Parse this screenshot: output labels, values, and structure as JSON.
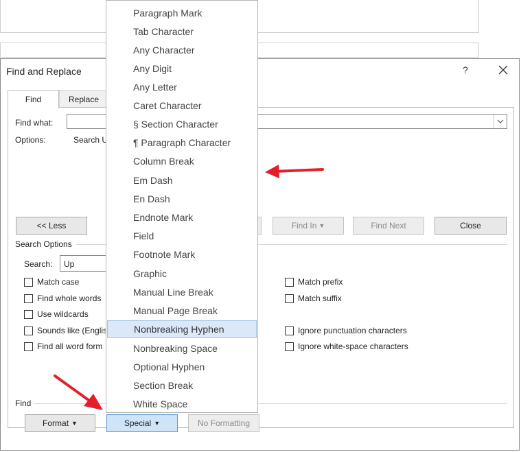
{
  "dialog": {
    "title": "Find and Replace",
    "help_label": "?",
    "tabs": [
      {
        "label": "Find",
        "active": true
      },
      {
        "label": "Replace",
        "active": false
      }
    ],
    "find_what_label": "Find what:",
    "options_label": "Options:",
    "options_value": "Search U",
    "buttons": {
      "less": "<< Less",
      "find_in": "Find In",
      "find_next": "Find Next",
      "close": "Close",
      "format": "Format",
      "special": "Special",
      "no_formatting": "No Formatting"
    },
    "search_options": {
      "group_label": "Search Options",
      "search_label": "Search:",
      "search_value": "Up",
      "left_checkboxes": [
        {
          "label": "Match case",
          "checked": false
        },
        {
          "label": "Find whole words",
          "checked": false
        },
        {
          "label": "Use wildcards",
          "checked": false
        },
        {
          "label": "Sounds like (Englis",
          "checked": false
        },
        {
          "label": "Find all word form",
          "checked": false
        }
      ],
      "right_checkboxes": [
        {
          "label": "Match prefix",
          "checked": false
        },
        {
          "label": "Match suffix",
          "checked": false
        },
        {
          "label": "Ignore punctuation characters",
          "checked": false
        },
        {
          "label": "Ignore white-space characters",
          "checked": false
        }
      ]
    },
    "find_group_label": "Find"
  },
  "special_menu": {
    "items": [
      "Paragraph Mark",
      "Tab Character",
      "Any Character",
      "Any Digit",
      "Any Letter",
      "Caret Character",
      "§ Section Character",
      "¶ Paragraph Character",
      "Column Break",
      "Em Dash",
      "En Dash",
      "Endnote Mark",
      "Field",
      "Footnote Mark",
      "Graphic",
      "Manual Line Break",
      "Manual Page Break",
      "Nonbreaking Hyphen",
      "Nonbreaking Space",
      "Optional Hyphen",
      "Section Break",
      "White Space"
    ],
    "highlighted": "Nonbreaking Hyphen"
  },
  "colors": {
    "annotation_arrow": "#e3202a",
    "highlight": "#dbe8f7"
  }
}
